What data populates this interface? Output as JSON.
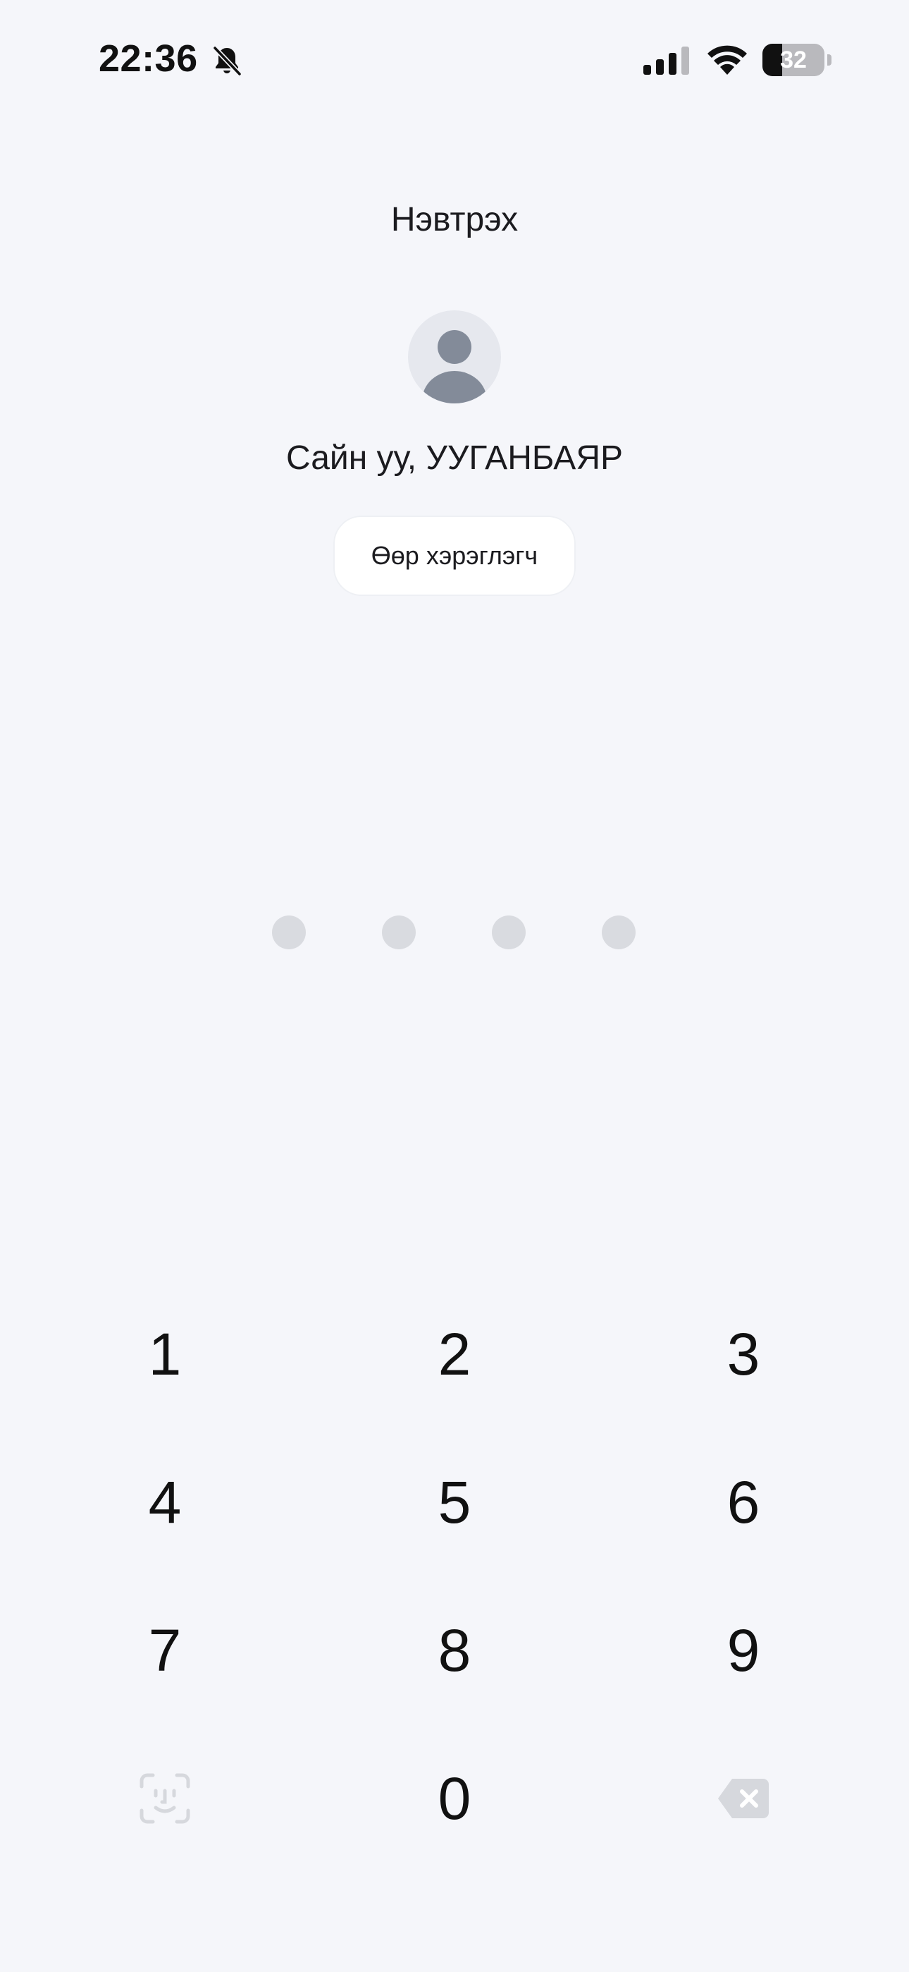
{
  "status_bar": {
    "time": "22:36",
    "battery_level": "32",
    "battery_fraction": 0.32,
    "icons": [
      "bell-slash-icon",
      "cellular-signal-icon",
      "wifi-icon",
      "battery-icon"
    ]
  },
  "header": {
    "title": "Нэвтрэх"
  },
  "user": {
    "avatar_icon": "person-icon",
    "greeting": "Сайн уу, УУГАНБАЯР"
  },
  "switch_user": {
    "label": "Өөр хэрэглэгч"
  },
  "pin": {
    "length": 4,
    "filled": 0
  },
  "keypad": {
    "keys": [
      "1",
      "2",
      "3",
      "4",
      "5",
      "6",
      "7",
      "8",
      "9",
      "0"
    ],
    "face_id_icon": "face-id-icon",
    "delete_icon": "backspace-icon"
  },
  "colors": {
    "background": "#f5f6fa",
    "text": "#111111",
    "dot_empty": "#d9dbe0",
    "disabled_icon": "#d6d8dd",
    "avatar_bg": "#e6e8ee",
    "avatar_fg": "#838b99"
  }
}
